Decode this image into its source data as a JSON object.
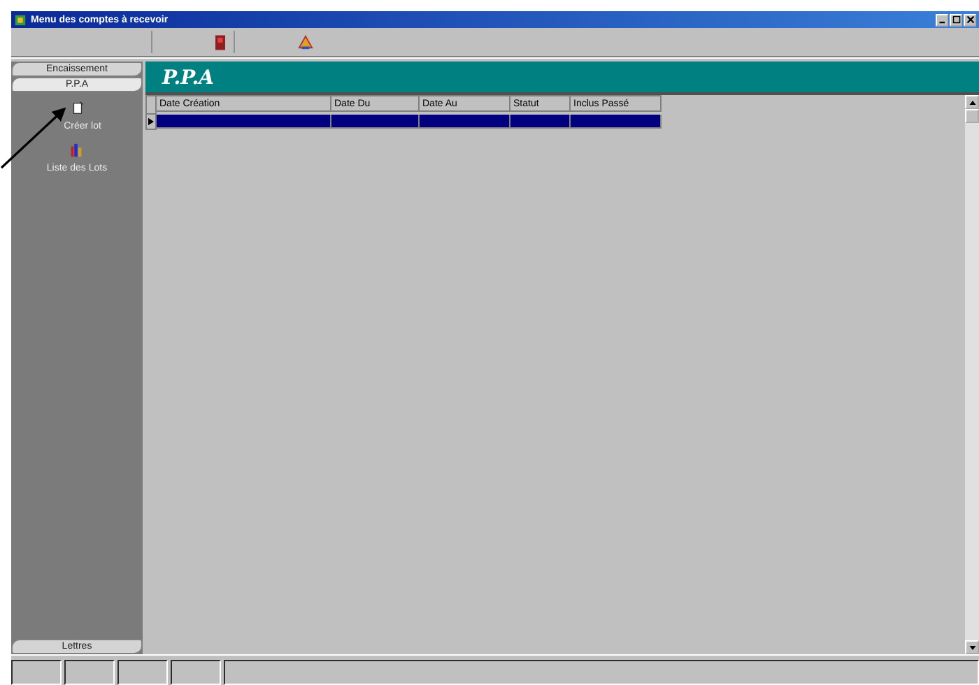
{
  "window": {
    "title": "Menu des comptes à recevoir"
  },
  "sidebar": {
    "groups": [
      {
        "label": "Encaissement",
        "selected": false
      },
      {
        "label": "P.P.A",
        "selected": true
      }
    ],
    "items": [
      {
        "label": "Créer lot",
        "kind": "create"
      },
      {
        "label": "Liste des Lots",
        "kind": "list"
      }
    ],
    "bottom_group": {
      "label": "Lettres",
      "selected": false
    }
  },
  "panel": {
    "title": "P.P.A"
  },
  "table": {
    "columns": [
      "Date Création",
      "Date Du",
      "Date Au",
      "Statut",
      "Inclus Passé"
    ],
    "rows": [
      {
        "selected": true
      }
    ]
  }
}
